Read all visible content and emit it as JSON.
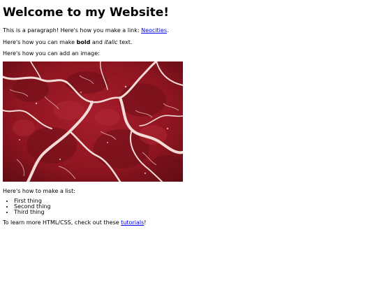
{
  "heading": "Welcome to my Website!",
  "para_link": {
    "prefix": "This is a paragraph! Here's how you make a link: ",
    "link_text": "Neocities",
    "suffix": "."
  },
  "para_format": {
    "prefix": "Here's how you can make ",
    "bold": "bold",
    "middle": " and ",
    "italic": "italic",
    "suffix": " text."
  },
  "para_image": "Here's how you can add an image:",
  "para_list": "Here's how to make a list:",
  "list_items": [
    "First thing",
    "Second thing",
    "Third thing"
  ],
  "para_tutorials": {
    "prefix": "To learn more HTML/CSS, check out these ",
    "link_text": "tutorials",
    "suffix": "!"
  },
  "colors": {
    "link": "#0000ee",
    "meat_base": "#8e1520",
    "meat_marbling": "#f3dcd8"
  },
  "image_subject": "raw-meat-photo"
}
